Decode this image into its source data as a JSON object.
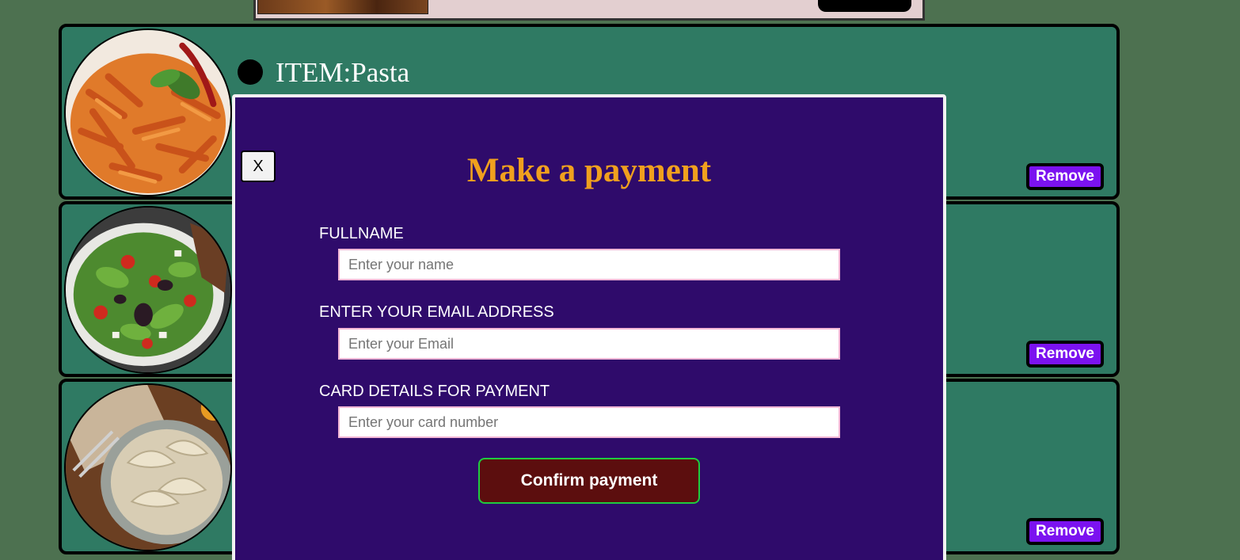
{
  "cart": {
    "items": [
      {
        "title": "ITEM:Pasta",
        "photo_icon": "pasta-photo-icon",
        "remove_label": "Remove"
      },
      {
        "title": "",
        "photo_icon": "salad-photo-icon",
        "remove_label": "Remove"
      },
      {
        "title": "",
        "photo_icon": "dumplings-photo-icon",
        "remove_label": "Remove"
      }
    ]
  },
  "payment_modal": {
    "close_label": "X",
    "title": "Make a payment",
    "fields": [
      {
        "label": "FULLNAME",
        "placeholder": "Enter your name"
      },
      {
        "label": "ENTER YOUR EMAIL ADDRESS",
        "placeholder": "Enter your Email"
      },
      {
        "label": "CARD DETAILS FOR PAYMENT",
        "placeholder": "Enter your card number"
      }
    ],
    "confirm_label": "Confirm payment"
  },
  "colors": {
    "page_background": "#4d7150",
    "card_background": "#2f7a63",
    "modal_background": "#2f0b6b",
    "modal_title": "#f0a01e",
    "remove_button": "#7b12f0",
    "confirm_button": "#5c0e0e",
    "confirm_border": "#1fcc3f"
  }
}
